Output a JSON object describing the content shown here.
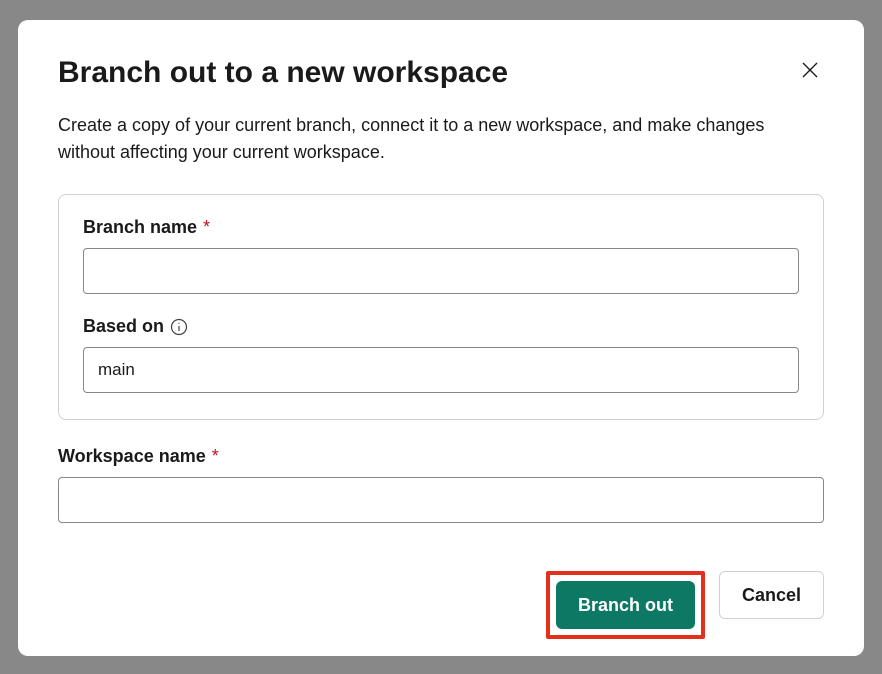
{
  "dialog": {
    "title": "Branch out to a new workspace",
    "description": "Create a copy of your current branch, connect it to a new workspace, and make changes without affecting your current workspace.",
    "fields": {
      "branch_name": {
        "label": "Branch name",
        "value": ""
      },
      "based_on": {
        "label": "Based on",
        "value": "main"
      },
      "workspace_name": {
        "label": "Workspace name",
        "value": ""
      }
    },
    "required_mark": "*",
    "buttons": {
      "primary": "Branch out",
      "secondary": "Cancel"
    }
  }
}
